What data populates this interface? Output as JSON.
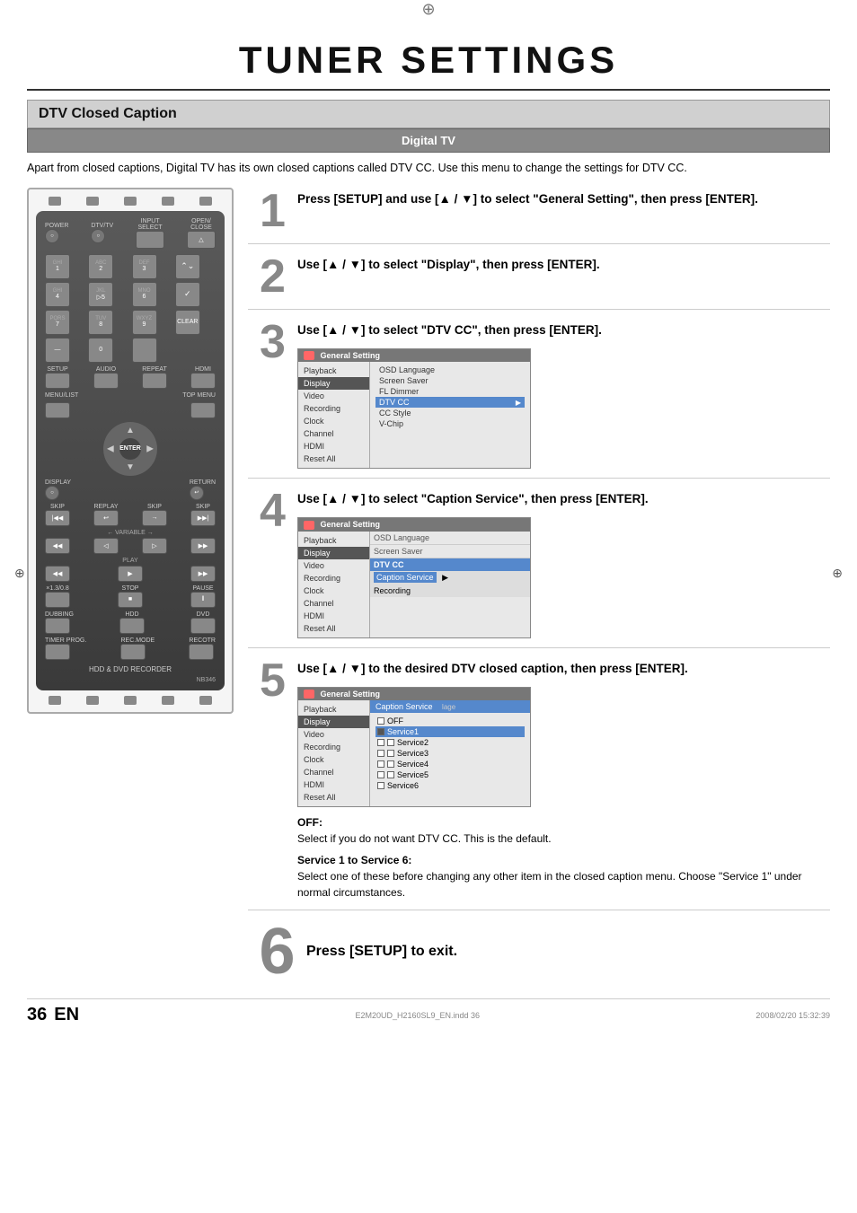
{
  "page": {
    "title": "TUNER SETTINGS",
    "section": "DTV Closed Caption",
    "sub_section": "Digital TV",
    "intro_text": "Apart from closed captions, Digital TV has its own closed captions called DTV CC. Use this menu to change the settings for DTV CC.",
    "page_number": "36",
    "en_label": "EN",
    "filename": "E2M20UD_H2160SL9_EN.indd  36",
    "date": "2008/02/20  15:32:39"
  },
  "steps": [
    {
      "number": "1",
      "text": "Press [SETUP] and use [▲ / ▼] to select \"General Setting\", then press [ENTER]."
    },
    {
      "number": "2",
      "text": "Use [▲ / ▼] to select \"Display\", then press [ENTER]."
    },
    {
      "number": "3",
      "text": "Use [▲ / ▼] to select \"DTV CC\", then press [ENTER]."
    },
    {
      "number": "4",
      "text": "Use [▲ / ▼] to select \"Caption Service\", then press [ENTER]."
    },
    {
      "number": "5",
      "text": "Use [▲ / ▼] to the desired DTV closed caption, then press [ENTER]."
    },
    {
      "number": "6",
      "text": "Press [SETUP] to exit."
    }
  ],
  "menu_step3": {
    "title": "General Setting",
    "left_items": [
      "Playback",
      "Display",
      "Video",
      "Recording",
      "Clock",
      "Channel",
      "HDMI",
      "Reset All"
    ],
    "selected_left": "Display",
    "right_items": [
      "OSD Language",
      "Screen Saver",
      "FL Dimmer",
      "DTV CC",
      "CC Style",
      "V-Chip"
    ],
    "highlighted_right": "DTV CC"
  },
  "menu_step4": {
    "title": "General Setting",
    "left_items": [
      "Playback",
      "Display",
      "Video",
      "Recording",
      "Clock",
      "Channel",
      "HDMI",
      "Reset All"
    ],
    "selected_left": "Display",
    "mid_label": "DTV CC",
    "mid_items": [
      "Caption Service",
      "Recording"
    ],
    "highlighted_mid": "Caption Service"
  },
  "menu_step5": {
    "title": "General Setting",
    "left_items": [
      "Playback",
      "Display",
      "Video",
      "Recording",
      "Clock",
      "Channel",
      "HDMI",
      "Reset All"
    ],
    "caption_title": "Caption Service",
    "caption_items": [
      "OFF",
      "Service1",
      "Service2",
      "Service3",
      "Service4",
      "Service5",
      "Service6"
    ],
    "selected_caption": "Service1"
  },
  "descriptions": {
    "off_title": "OFF:",
    "off_text": "Select if you do not want DTV CC. This is the default.",
    "service_title": "Service 1 to Service 6:",
    "service_text": "Select one of these before changing any other item in the closed caption menu. Choose \"Service 1\" under normal circumstances."
  },
  "remote": {
    "model": "NB346",
    "bottom_label": "HDD & DVD RECORDER",
    "buttons": {
      "power": "POWER",
      "dtv_tv": "DTV/TV",
      "input_select": "INPUT SELECT",
      "open_close": "OPEN/CLOSE",
      "setup": "SETUP",
      "audio": "AUDIO",
      "repeat": "REPEAT",
      "hdmi": "HDMI",
      "menu_list": "MENU/LIST",
      "top_menu": "TOP MENU",
      "display": "DISPLAY",
      "return": "RETURN",
      "skip_back": "SKIP",
      "replay": "REPLAY",
      "skip_fwd": "SKIP",
      "skip_end": "SKIP",
      "prev": "◀◀",
      "rew": "◀",
      "fwd": "▶",
      "next": "▶▶",
      "play_back": "◀◀",
      "play": "▶",
      "play_fwd": "▶▶",
      "x1_3_0_8": "×1.3/0.8",
      "stop": "STOP",
      "pause": "PAUSE",
      "dubbing": "DUBBING",
      "hdd": "HDD",
      "dvd": "DVD",
      "timer_prog": "TIMER PROG.",
      "rec_mode": "REC.MODE",
      "record": "RECOTR",
      "enter": "ENTER"
    }
  }
}
